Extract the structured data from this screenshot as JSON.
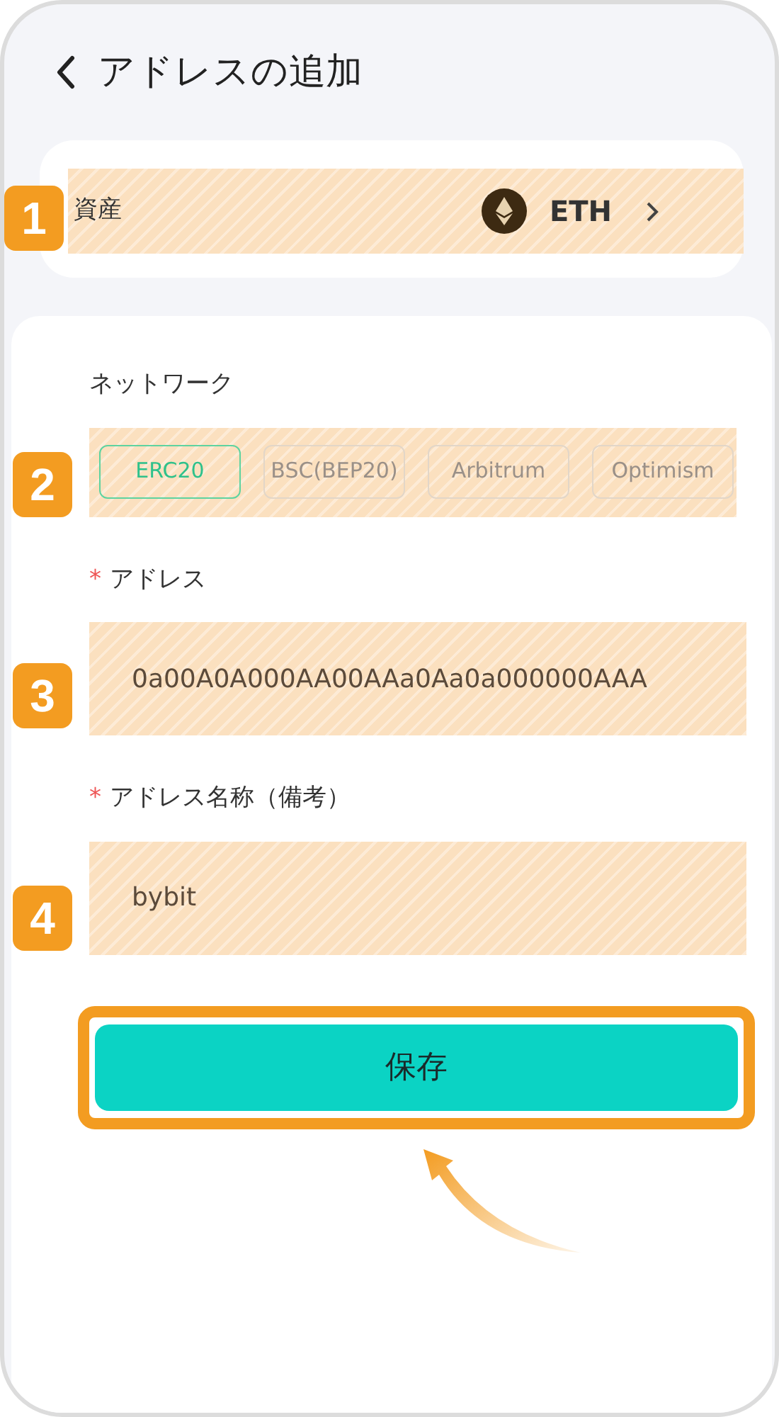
{
  "header": {
    "title": "アドレスの追加"
  },
  "asset": {
    "callout": "1",
    "label": "資産",
    "value": "ETH"
  },
  "network": {
    "label": "ネットワーク",
    "callout": "2",
    "options": [
      {
        "label": "ERC20",
        "selected": true
      },
      {
        "label": "BSC(BEP20)",
        "selected": false
      },
      {
        "label": "Arbitrum",
        "selected": false
      },
      {
        "label": "Optimism",
        "selected": false
      }
    ]
  },
  "fields": [
    {
      "mark": "*",
      "label": "アドレス",
      "callout": "3",
      "value": "0a00A0A000AA00AAa0Aa0a000000AAA"
    },
    {
      "mark": "*",
      "label": "アドレス名称（備考）",
      "callout": "4",
      "value": "bybit"
    }
  ],
  "save_button": {
    "label": "保存"
  }
}
